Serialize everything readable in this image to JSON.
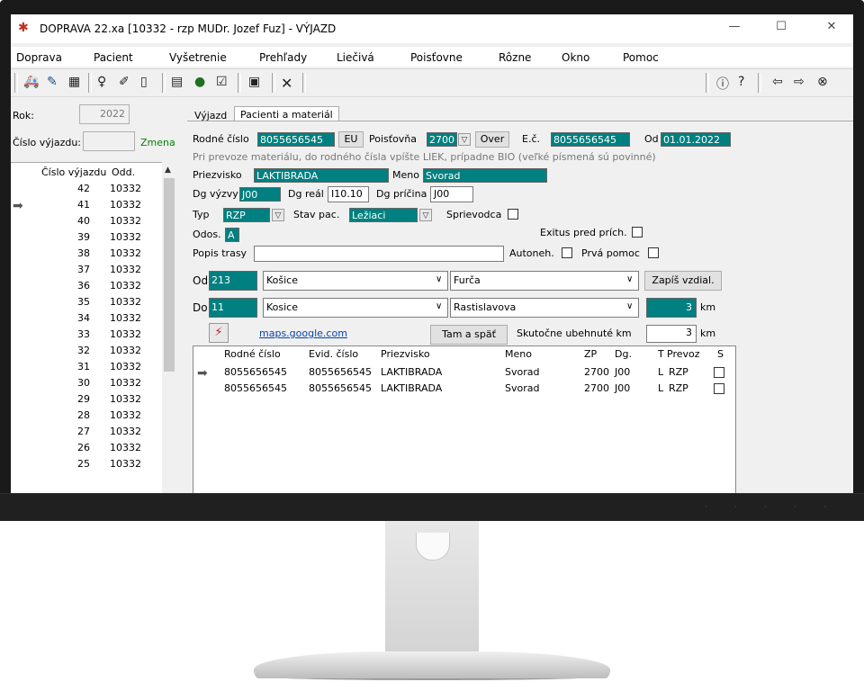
{
  "window": {
    "title": "DOPRAVA 22.xa [10332 - rzp MUDr. Jozef Fuz] - VÝJAZD",
    "minimize_icon": "—",
    "maximize_icon": "☐",
    "close_icon": "✕"
  },
  "menu": [
    "Doprava",
    "Pacient",
    "Vyšetrenie",
    "Prehľady",
    "Liečivá",
    "Poisťovne",
    "Rôzne",
    "Okno",
    "Pomoc"
  ],
  "left": {
    "rok_label": "Rok:",
    "rok_value": "2022",
    "cislo_label": "Číslo výjazdu:",
    "cislo_value": "",
    "zmena": "Zmena",
    "col_cislo": "Číslo výjazdu",
    "col_odd": "Odd.",
    "rows": [
      {
        "n": "42",
        "o": "10332"
      },
      {
        "n": "41",
        "o": "10332"
      },
      {
        "n": "40",
        "o": "10332"
      },
      {
        "n": "39",
        "o": "10332"
      },
      {
        "n": "38",
        "o": "10332"
      },
      {
        "n": "37",
        "o": "10332"
      },
      {
        "n": "36",
        "o": "10332"
      },
      {
        "n": "35",
        "o": "10332"
      },
      {
        "n": "34",
        "o": "10332"
      },
      {
        "n": "33",
        "o": "10332"
      },
      {
        "n": "32",
        "o": "10332"
      },
      {
        "n": "31",
        "o": "10332"
      },
      {
        "n": "30",
        "o": "10332"
      },
      {
        "n": "29",
        "o": "10332"
      },
      {
        "n": "28",
        "o": "10332"
      },
      {
        "n": "27",
        "o": "10332"
      },
      {
        "n": "26",
        "o": "10332"
      },
      {
        "n": "25",
        "o": "10332"
      }
    ]
  },
  "tabs": {
    "vyjazd": "Výjazd",
    "pacienti": "Pacienti a materiál"
  },
  "form": {
    "rc_label": "Rodné číslo",
    "rc_value": "8055656545",
    "eu": "EU",
    "poist_label": "Poisťovňa",
    "poist_value": "2700",
    "over": "Over",
    "ec_label": "E.č.",
    "ec_value": "8055656545",
    "od_label": "Od",
    "od_value": "01.01.2022",
    "hint": "Pri prevoze materiálu, do rodného čísla vpíšte LIEK, prípadne BIO (veľké písmená sú povinné)",
    "priezvisko_label": "Priezvisko",
    "priezvisko_value": "LAKTIBRADA",
    "meno_label": "Meno",
    "meno_value": "Svorad",
    "dgv_label": "Dg výzvy",
    "dgv_value": "J00",
    "dgr_label": "Dg reál",
    "dgr_value": "I10.10",
    "dgp_label": "Dg príčina",
    "dgp_value": "J00",
    "typ_label": "Typ",
    "typ_value": "RZP",
    "stav_label": "Stav pac.",
    "stav_value": "Ležiaci",
    "sprievodca_label": "Sprievodca",
    "odos_label": "Odos.",
    "odos_value": "A",
    "exitus_label": "Exitus pred prích.",
    "popis_label": "Popis trasy",
    "popis_value": "",
    "autoneh_label": "Autoneh.",
    "prva_label": "Prvá pomoc",
    "od2_label": "Od",
    "od_code": "213",
    "od_city": "Košice",
    "od_street": "Furča",
    "zapis": "Zapíš vzdial.",
    "do_label": "Do",
    "do_code": "11",
    "do_city": "Kosice",
    "do_street": "Rastislavova",
    "km_value": "3",
    "km_label": "km",
    "maps": "maps.google.com",
    "tam": "Tam a späť",
    "skut_label": "Skutočne ubehnuté km",
    "skut_value": "3",
    "skut_km": "km"
  },
  "grid": {
    "headers": [
      "Rodné číslo",
      "Evid. číslo",
      "Priezvisko",
      "Meno",
      "ZP",
      "Dg.",
      "T",
      "Prevoz",
      "S"
    ],
    "rows": [
      {
        "rc": "8055656545",
        "ec": "8055656545",
        "pr": "LAKTIBRADA",
        "me": "Svorad",
        "zp": "2700",
        "dg": "J00",
        "t": "L",
        "pv": "RZP"
      },
      {
        "rc": "8055656545",
        "ec": "8055656545",
        "pr": "LAKTIBRADA",
        "me": "Svorad",
        "zp": "2700",
        "dg": "J00",
        "t": "L",
        "pv": "RZP"
      }
    ]
  },
  "colors": {
    "teal": "#008080",
    "green": "#008000",
    "link": "#0645ad"
  }
}
